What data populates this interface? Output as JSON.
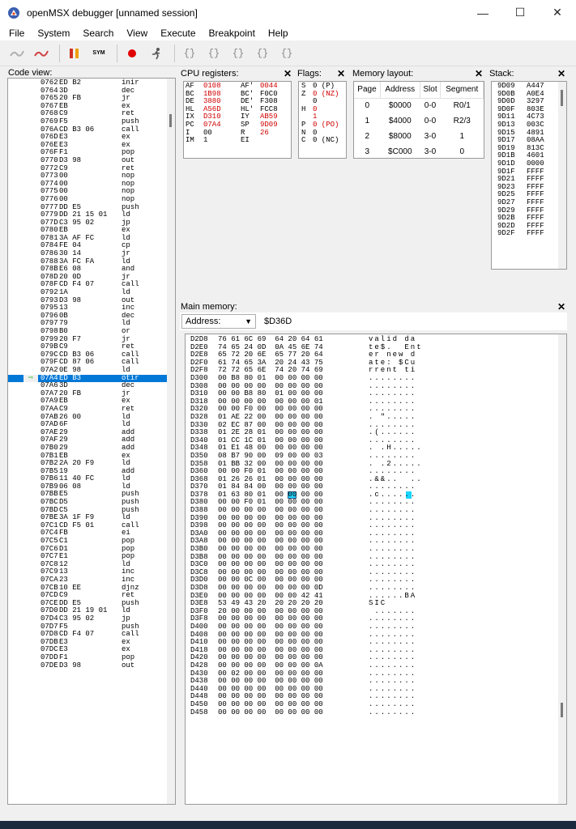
{
  "window": {
    "title": "openMSX debugger [unnamed session]",
    "minimize": "—",
    "maximize": "☐",
    "close": "✕"
  },
  "menu": [
    "File",
    "System",
    "Search",
    "View",
    "Execute",
    "Breakpoint",
    "Help"
  ],
  "toolbar": {
    "symbols_label": "SYM",
    "step_in_label": "{}",
    "step_over_label": "{}",
    "step_out_label": "{}",
    "run_to_label": "{}",
    "step_back_label": "{}"
  },
  "code_view": {
    "title": "Code view:",
    "pc_marker_icon": "arrow-right-icon",
    "rows": [
      [
        "0762",
        "ED B2",
        "inir"
      ],
      [
        "0764",
        "3D",
        "dec"
      ],
      [
        "0765",
        "20 FB",
        "jr"
      ],
      [
        "0767",
        "EB",
        "ex"
      ],
      [
        "0768",
        "C9",
        "ret"
      ],
      [
        "0769",
        "F5",
        "push"
      ],
      [
        "076A",
        "CD B3 06",
        "call"
      ],
      [
        "076D",
        "E3",
        "ex"
      ],
      [
        "076E",
        "E3",
        "ex"
      ],
      [
        "076F",
        "F1",
        "pop"
      ],
      [
        "0770",
        "D3 98",
        "out"
      ],
      [
        "0772",
        "C9",
        "ret"
      ],
      [
        "0773",
        "00",
        "nop"
      ],
      [
        "0774",
        "00",
        "nop"
      ],
      [
        "0775",
        "00",
        "nop"
      ],
      [
        "0776",
        "00",
        "nop"
      ],
      [
        "0777",
        "DD E5",
        "push"
      ],
      [
        "0779",
        "DD 21 15 01",
        "ld"
      ],
      [
        "077D",
        "C3 95 02",
        "jp"
      ],
      [
        "0780",
        "EB",
        "ex"
      ],
      [
        "0781",
        "3A AF FC",
        "ld"
      ],
      [
        "0784",
        "FE 04",
        "cp"
      ],
      [
        "0786",
        "30 14",
        "jr"
      ],
      [
        "0788",
        "3A FC FA",
        "ld"
      ],
      [
        "078B",
        "E6 08",
        "and"
      ],
      [
        "078D",
        "20 0D",
        "jr"
      ],
      [
        "078F",
        "CD F4 07",
        "call"
      ],
      [
        "0792",
        "1A",
        "ld"
      ],
      [
        "0793",
        "D3 98",
        "out"
      ],
      [
        "0795",
        "13",
        "inc"
      ],
      [
        "0796",
        "0B",
        "dec"
      ],
      [
        "0797",
        "79",
        "ld"
      ],
      [
        "0798",
        "B0",
        "or"
      ],
      [
        "0799",
        "20 F7",
        "jr"
      ],
      [
        "079B",
        "C9",
        "ret"
      ],
      [
        "079C",
        "CD B3 06",
        "call"
      ],
      [
        "079F",
        "CD 87 06",
        "call"
      ],
      [
        "07A2",
        "0E 98",
        "ld"
      ],
      [
        "07A4",
        "ED B3",
        "otir"
      ],
      [
        "07A6",
        "3D",
        "dec"
      ],
      [
        "07A7",
        "20 FB",
        "jr"
      ],
      [
        "07A9",
        "EB",
        "ex"
      ],
      [
        "07AA",
        "C9",
        "ret"
      ],
      [
        "07AB",
        "26 00",
        "ld"
      ],
      [
        "07AD",
        "6F",
        "ld"
      ],
      [
        "07AE",
        "29",
        "add"
      ],
      [
        "07AF",
        "29",
        "add"
      ],
      [
        "07B0",
        "29",
        "add"
      ],
      [
        "07B1",
        "EB",
        "ex"
      ],
      [
        "07B2",
        "2A 20 F9",
        "ld"
      ],
      [
        "07B5",
        "19",
        "add"
      ],
      [
        "07B6",
        "11 40 FC",
        "ld"
      ],
      [
        "07B9",
        "06 08",
        "ld"
      ],
      [
        "07BB",
        "E5",
        "push"
      ],
      [
        "07BC",
        "D5",
        "push"
      ],
      [
        "07BD",
        "C5",
        "push"
      ],
      [
        "07BE",
        "3A 1F F9",
        "ld"
      ],
      [
        "07C1",
        "CD F5 01",
        "call"
      ],
      [
        "07C4",
        "FB",
        "ei"
      ],
      [
        "07C5",
        "C1",
        "pop"
      ],
      [
        "07C6",
        "D1",
        "pop"
      ],
      [
        "07C7",
        "E1",
        "pop"
      ],
      [
        "07C8",
        "12",
        "ld"
      ],
      [
        "07C9",
        "13",
        "inc"
      ],
      [
        "07CA",
        "23",
        "inc"
      ],
      [
        "07CB",
        "10 EE",
        "djnz"
      ],
      [
        "07CD",
        "C9",
        "ret"
      ],
      [
        "07CE",
        "DD E5",
        "push"
      ],
      [
        "07D0",
        "DD 21 19 01",
        "ld"
      ],
      [
        "07D4",
        "C3 95 02",
        "jp"
      ],
      [
        "07D7",
        "F5",
        "push"
      ],
      [
        "07D8",
        "CD F4 07",
        "call"
      ],
      [
        "07DB",
        "E3",
        "ex"
      ],
      [
        "07DC",
        "E3",
        "ex"
      ],
      [
        "07DD",
        "F1",
        "pop"
      ],
      [
        "07DE",
        "D3 98",
        "out"
      ]
    ],
    "selected_index": 38
  },
  "cpu_registers": {
    "title": "CPU registers:",
    "rows": [
      {
        "n1": "AF",
        "v1": "0108",
        "c1": "#d00000",
        "n2": "AF'",
        "v2": "0044",
        "c2": "#d00000"
      },
      {
        "n1": "BC",
        "v1": "1B98",
        "c1": "#d00000",
        "n2": "BC'",
        "v2": "F0C0",
        "c2": "#000000"
      },
      {
        "n1": "DE",
        "v1": "3880",
        "c1": "#d00000",
        "n2": "DE'",
        "v2": "F308",
        "c2": "#000000"
      },
      {
        "n1": "HL",
        "v1": "A56D",
        "c1": "#d00000",
        "n2": "HL'",
        "v2": "FCC8",
        "c2": "#000000"
      },
      {
        "n1": "IX",
        "v1": "D310",
        "c1": "#d00000",
        "n2": "IY",
        "v2": "AB59",
        "c2": "#d00000"
      },
      {
        "n1": "PC",
        "v1": "07A4",
        "c1": "#d00000",
        "n2": "SP",
        "v2": "9D09",
        "c2": "#d00000"
      },
      {
        "n1": "I",
        "v1": "00",
        "c1": "#000000",
        "n2": "R",
        "v2": "26",
        "c2": "#d00000"
      },
      {
        "n1": "IM",
        "v1": "1",
        "c1": "#000000",
        "n2": "EI",
        "v2": "",
        "c2": "#000000"
      }
    ]
  },
  "flags": {
    "title": "Flags:",
    "rows": [
      {
        "n": "S",
        "v": "0 (P)",
        "c": "#000000"
      },
      {
        "n": "Z",
        "v": "0 (NZ)",
        "c": "#d00000"
      },
      {
        "n": "",
        "v": "0",
        "c": "#000000"
      },
      {
        "n": "H",
        "v": "0",
        "c": "#d00000"
      },
      {
        "n": "",
        "v": "1",
        "c": "#d00000"
      },
      {
        "n": "P",
        "v": "0 (PO)",
        "c": "#d00000"
      },
      {
        "n": "N",
        "v": "0",
        "c": "#000000"
      },
      {
        "n": "C",
        "v": "0 (NC)",
        "c": "#000000"
      }
    ]
  },
  "memory_layout": {
    "title": "Memory layout:",
    "headers": [
      "Page",
      "Address",
      "Slot",
      "Segment"
    ],
    "rows": [
      [
        "0",
        "$0000",
        "0-0",
        "R0/1"
      ],
      [
        "1",
        "$4000",
        "0-0",
        "R2/3"
      ],
      [
        "2",
        "$8000",
        "3-0",
        "1"
      ],
      [
        "3",
        "$C000",
        "3-0",
        "0"
      ]
    ]
  },
  "stack": {
    "title": "Stack:",
    "rows": [
      [
        "9D09",
        "A447"
      ],
      [
        "9D0B",
        "A0E4"
      ],
      [
        "9D0D",
        "3297"
      ],
      [
        "9D0F",
        "803E"
      ],
      [
        "9D11",
        "4C73"
      ],
      [
        "9D13",
        "003C"
      ],
      [
        "9D15",
        "4891"
      ],
      [
        "9D17",
        "08AA"
      ],
      [
        "9D19",
        "813C"
      ],
      [
        "9D1B",
        "4601"
      ],
      [
        "9D1D",
        "0000"
      ],
      [
        "9D1F",
        "FFFF"
      ],
      [
        "9D21",
        "FFFF"
      ],
      [
        "9D23",
        "FFFF"
      ],
      [
        "9D25",
        "FFFF"
      ],
      [
        "9D27",
        "FFFF"
      ],
      [
        "9D29",
        "FFFF"
      ],
      [
        "9D2B",
        "FFFF"
      ],
      [
        "9D2D",
        "FFFF"
      ],
      [
        "9D2F",
        "FFFF"
      ]
    ]
  },
  "main_memory": {
    "title": "Main memory:",
    "address_mode": "Address:",
    "address_value": "$D36D",
    "cursor_row": 20,
    "cursor_byte": 5,
    "cursor_char_row": 20,
    "rows": [
      [
        "D2D8",
        "76 61 6C 69  64 20 64 61",
        "valid da"
      ],
      [
        "D2E0",
        "74 65 24 0D  0A 45 6E 74",
        "te$.  Ent"
      ],
      [
        "D2E8",
        "65 72 20 6E  65 77 20 64",
        "er new d"
      ],
      [
        "D2F0",
        "61 74 65 3A  20 24 43 75",
        "ate: $Cu"
      ],
      [
        "D2F8",
        "72 72 65 6E  74 20 74 69",
        "rrent ti"
      ],
      [
        "D300",
        "00 B8 80 01  00 00 00 00",
        "........"
      ],
      [
        "D308",
        "00 00 00 00  00 00 00 00",
        "........"
      ],
      [
        "D310",
        "00 00 B8 80  01 00 00 00",
        "........"
      ],
      [
        "D318",
        "00 00 00 00  00 00 00 01",
        "........"
      ],
      [
        "D320",
        "00 00 F0 00  00 00 00 00",
        "........"
      ],
      [
        "D328",
        "01 AE 22 00  00 00 00 00",
        ". \"....."
      ],
      [
        "D330",
        "02 EC 87 00  00 00 00 00",
        "........"
      ],
      [
        "D338",
        "01 2E 28 01  00 00 00 00",
        ".(......"
      ],
      [
        "D340",
        "01 CC 1C 01  00 00 00 00",
        "........"
      ],
      [
        "D348",
        "01 E1 48 00  00 00 00 00",
        ". .H....."
      ],
      [
        "D350",
        "08 B7 90 00  09 00 00 03",
        "........"
      ],
      [
        "D358",
        "01 BB 32 00  00 00 00 00",
        ". .2....."
      ],
      [
        "D360",
        "00 00 F0 01  00 00 00 00",
        "........"
      ],
      [
        "D368",
        "01 26 26 01  00 00 00 00",
        ".&&..  .."
      ],
      [
        "D370",
        "01 84 84 00  00 00 00 00",
        "........"
      ],
      [
        "D378",
        "01 63 80 01  00 00 00 00",
        ".c......"
      ],
      [
        "D380",
        "00 00 F0 01  00 00 00 00",
        "........"
      ],
      [
        "D388",
        "00 00 00 00  00 00 00 00",
        "........"
      ],
      [
        "D390",
        "00 00 00 00  00 00 00 00",
        "........"
      ],
      [
        "D398",
        "00 00 00 00  00 00 00 00",
        "........"
      ],
      [
        "D3A0",
        "00 00 00 00  00 00 00 00",
        "........"
      ],
      [
        "D3A8",
        "00 00 00 00  00 00 00 00",
        "........"
      ],
      [
        "D3B0",
        "00 00 00 00  00 00 00 00",
        "........"
      ],
      [
        "D3B8",
        "00 00 00 00  00 00 00 00",
        "........"
      ],
      [
        "D3C0",
        "00 00 00 00  00 00 00 00",
        "........"
      ],
      [
        "D3C8",
        "00 00 00 00  00 00 00 00",
        "........"
      ],
      [
        "D3D0",
        "00 00 0C 00  00 00 00 00",
        "........"
      ],
      [
        "D3D8",
        "00 00 00 00  00 00 00 0D",
        "........"
      ],
      [
        "D3E0",
        "00 00 00 00  00 00 42 41",
        "......BA"
      ],
      [
        "D3E8",
        "53 49 43 20  20 20 20 20",
        "SIC     "
      ],
      [
        "D3F0",
        "20 00 00 00  00 00 00 00",
        " ......."
      ],
      [
        "D3F8",
        "00 00 00 00  00 00 00 00",
        "........"
      ],
      [
        "D400",
        "00 00 00 00  00 00 00 00",
        "........"
      ],
      [
        "D408",
        "00 00 00 00  00 00 00 00",
        "........"
      ],
      [
        "D410",
        "00 00 00 00  00 00 00 00",
        "........"
      ],
      [
        "D418",
        "00 00 00 00  00 00 00 00",
        "........"
      ],
      [
        "D420",
        "00 00 00 00  00 00 00 00",
        "........"
      ],
      [
        "D428",
        "00 00 00 00  00 00 00 0A",
        "........"
      ],
      [
        "D430",
        "00 02 00 00  00 00 00 00",
        "........"
      ],
      [
        "D438",
        "00 00 00 00  00 00 00 00",
        "........"
      ],
      [
        "D440",
        "00 00 00 00  00 00 00 00",
        "........"
      ],
      [
        "D448",
        "00 00 00 00  00 00 00 00",
        "........"
      ],
      [
        "D450",
        "00 00 00 00  00 00 00 00",
        "........"
      ],
      [
        "D458",
        "00 00 00 00  00 00 00 00",
        "........"
      ]
    ]
  },
  "colors": {
    "selection": "#0078d7",
    "changed_value": "#d00000",
    "cursor": "#00d0ff"
  }
}
